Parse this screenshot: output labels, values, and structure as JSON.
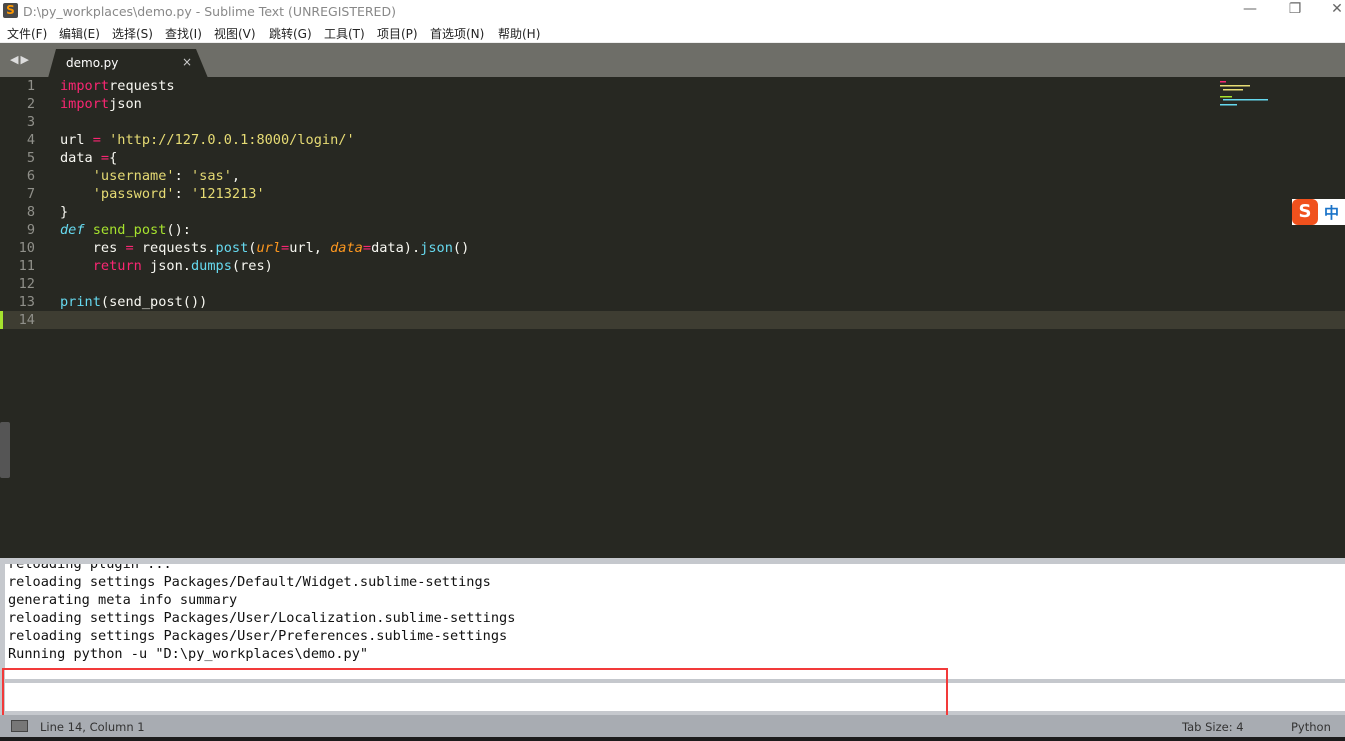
{
  "window": {
    "title": "D:\\py_workplaces\\demo.py - Sublime Text (UNREGISTERED)",
    "app_icon": "S",
    "minimize": "—",
    "restore": "❐",
    "close": "✕"
  },
  "menu": [
    "文件(F)",
    "编辑(E)",
    "选择(S)",
    "查找(I)",
    "视图(V)",
    "跳转(G)",
    "工具(T)",
    "项目(P)",
    "首选项(N)",
    "帮助(H)"
  ],
  "tabs": {
    "nav": "◀▶",
    "active": {
      "label": "demo.py",
      "close": "×"
    }
  },
  "editor": {
    "current_line": 14,
    "lines": [
      [
        [
          "kw",
          "import"
        ],
        [
          "",
          "requests"
        ]
      ],
      [
        [
          "kw",
          "import"
        ],
        [
          "",
          "json"
        ]
      ],
      [],
      [
        [
          "",
          "url "
        ],
        [
          "op",
          "="
        ],
        [
          "",
          " "
        ],
        [
          "str",
          "'http://127.0.0.1:8000/login/'"
        ]
      ],
      [
        [
          "",
          "data "
        ],
        [
          "op",
          "="
        ],
        [
          "",
          "{"
        ]
      ],
      [
        [
          "",
          "    "
        ],
        [
          "str",
          "'username'"
        ],
        [
          "",
          ": "
        ],
        [
          "str",
          "'sas'"
        ],
        [
          "",
          ","
        ]
      ],
      [
        [
          "",
          "    "
        ],
        [
          "str",
          "'password'"
        ],
        [
          "",
          ": "
        ],
        [
          "str",
          "'1213213'"
        ]
      ],
      [
        [
          "",
          "}"
        ]
      ],
      [
        [
          "def",
          "def"
        ],
        [
          "",
          " "
        ],
        [
          "fn",
          "send_post"
        ],
        [
          "",
          "():"
        ]
      ],
      [
        [
          "",
          "    res "
        ],
        [
          "op",
          "="
        ],
        [
          "",
          " requests."
        ],
        [
          "call",
          "post"
        ],
        [
          "",
          "("
        ],
        [
          "arg",
          "url"
        ],
        [
          "op",
          "="
        ],
        [
          "",
          "url, "
        ],
        [
          "arg",
          "data"
        ],
        [
          "op",
          "="
        ],
        [
          "",
          "data)."
        ],
        [
          "call",
          "json"
        ],
        [
          "",
          "()"
        ]
      ],
      [
        [
          "",
          "    "
        ],
        [
          "kw",
          "return"
        ],
        [
          "",
          " json."
        ],
        [
          "call",
          "dumps"
        ],
        [
          "",
          "(res)"
        ]
      ],
      [],
      [
        [
          "call",
          "print"
        ],
        [
          "",
          "(send_post())"
        ]
      ],
      []
    ]
  },
  "ime": {
    "logo": "S",
    "mode": "中"
  },
  "console": {
    "lines": [
      "reloading plugin ...",
      "reloading settings Packages/Default/Widget.sublime-settings",
      "generating meta info summary",
      "reloading settings Packages/User/Localization.sublime-settings",
      "reloading settings Packages/User/Preferences.sublime-settings",
      "Running python -u \"D:\\py_workplaces\\demo.py\""
    ],
    "input_value": ""
  },
  "status": {
    "position": "Line 14, Column 1",
    "tab_size": "Tab Size: 4",
    "syntax": "Python"
  },
  "colors": {
    "editor_bg": "#272822",
    "keyword": "#f92672",
    "string": "#e6db74",
    "function": "#a6e22e",
    "builtin": "#66d9ef",
    "argument": "#fd971f",
    "highlight_box": "#f23a3a"
  }
}
